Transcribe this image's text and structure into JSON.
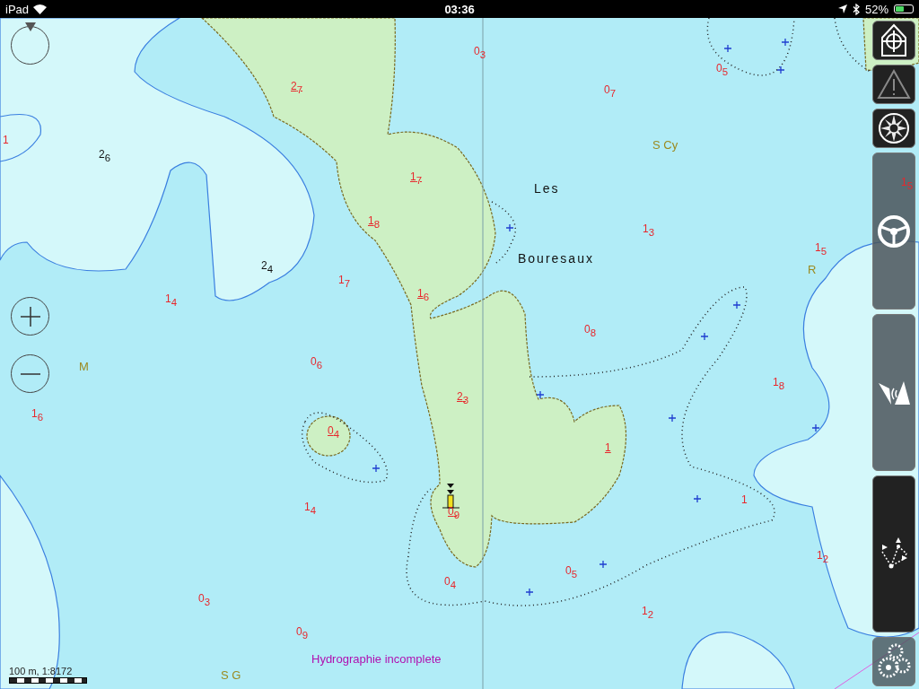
{
  "status_bar": {
    "device": "iPad",
    "time": "03:36",
    "battery_text": "52%",
    "battery": {
      "level": 0.52
    }
  },
  "chart": {
    "soundings": [
      {
        "text": "0$_{3}$",
        "kind": "depth"
      },
      {
        "text": "2$_{7}$",
        "kind": "drying"
      },
      {
        "text": "0$_{7}$",
        "kind": "depth"
      },
      {
        "text": "0$_{5}$",
        "kind": "depth"
      },
      {
        "text": "1",
        "kind": "depth"
      },
      {
        "text": "2$_{6}$",
        "kind": "height"
      },
      {
        "text": "S Cy",
        "kind": "seabed"
      },
      {
        "text": "1$_{7}$",
        "kind": "drying"
      },
      {
        "text": "Les",
        "kind": "name"
      },
      {
        "text": "1$_{5}$",
        "kind": "depth"
      },
      {
        "text": "1$_{8}$",
        "kind": "drying"
      },
      {
        "text": "1$_{3}$",
        "kind": "depth"
      },
      {
        "text": "1$_{5}$",
        "kind": "depth"
      },
      {
        "text": "Bouresaux",
        "kind": "name"
      },
      {
        "text": "R",
        "kind": "seabed"
      },
      {
        "text": "2$_{4}$",
        "kind": "height"
      },
      {
        "text": "1$_{7}$",
        "kind": "depth"
      },
      {
        "text": "1$_{6}$",
        "kind": "drying"
      },
      {
        "text": "1$_{4}$",
        "kind": "depth"
      },
      {
        "text": "0$_{8}$",
        "kind": "depth"
      },
      {
        "text": "M",
        "kind": "seabed"
      },
      {
        "text": "0$_{6}$",
        "kind": "depth"
      },
      {
        "text": "1$_{8}$",
        "kind": "depth"
      },
      {
        "text": "2$_{3}$",
        "kind": "drying"
      },
      {
        "text": "1$_{6}$",
        "kind": "depth"
      },
      {
        "text": "0$_{4}$",
        "kind": "drying"
      },
      {
        "text": "1",
        "kind": "drying"
      },
      {
        "text": "1",
        "kind": "depth"
      },
      {
        "text": "1$_{4}$",
        "kind": "depth"
      },
      {
        "text": "0$_{9}$",
        "kind": "drying"
      },
      {
        "text": "1$_{2}$",
        "kind": "depth"
      },
      {
        "text": "0$_{5}$",
        "kind": "depth"
      },
      {
        "text": "0$_{4}$",
        "kind": "depth"
      },
      {
        "text": "0$_{3}$",
        "kind": "depth"
      },
      {
        "text": "1$_{2}$",
        "kind": "depth"
      },
      {
        "text": "0$_{9}$",
        "kind": "depth"
      },
      {
        "text": "Hydrographie incomplete",
        "kind": "notice"
      },
      {
        "text": "S G",
        "kind": "seabed"
      }
    ],
    "scale": "100 m, 1:8172"
  },
  "side_buttons": [
    {
      "kind": "square"
    },
    {
      "kind": "square"
    },
    {
      "kind": "square"
    },
    {
      "kind": "panel"
    },
    {
      "kind": "panel"
    },
    {
      "kind": "panel_dark"
    },
    {
      "kind": "panel_small"
    }
  ]
}
